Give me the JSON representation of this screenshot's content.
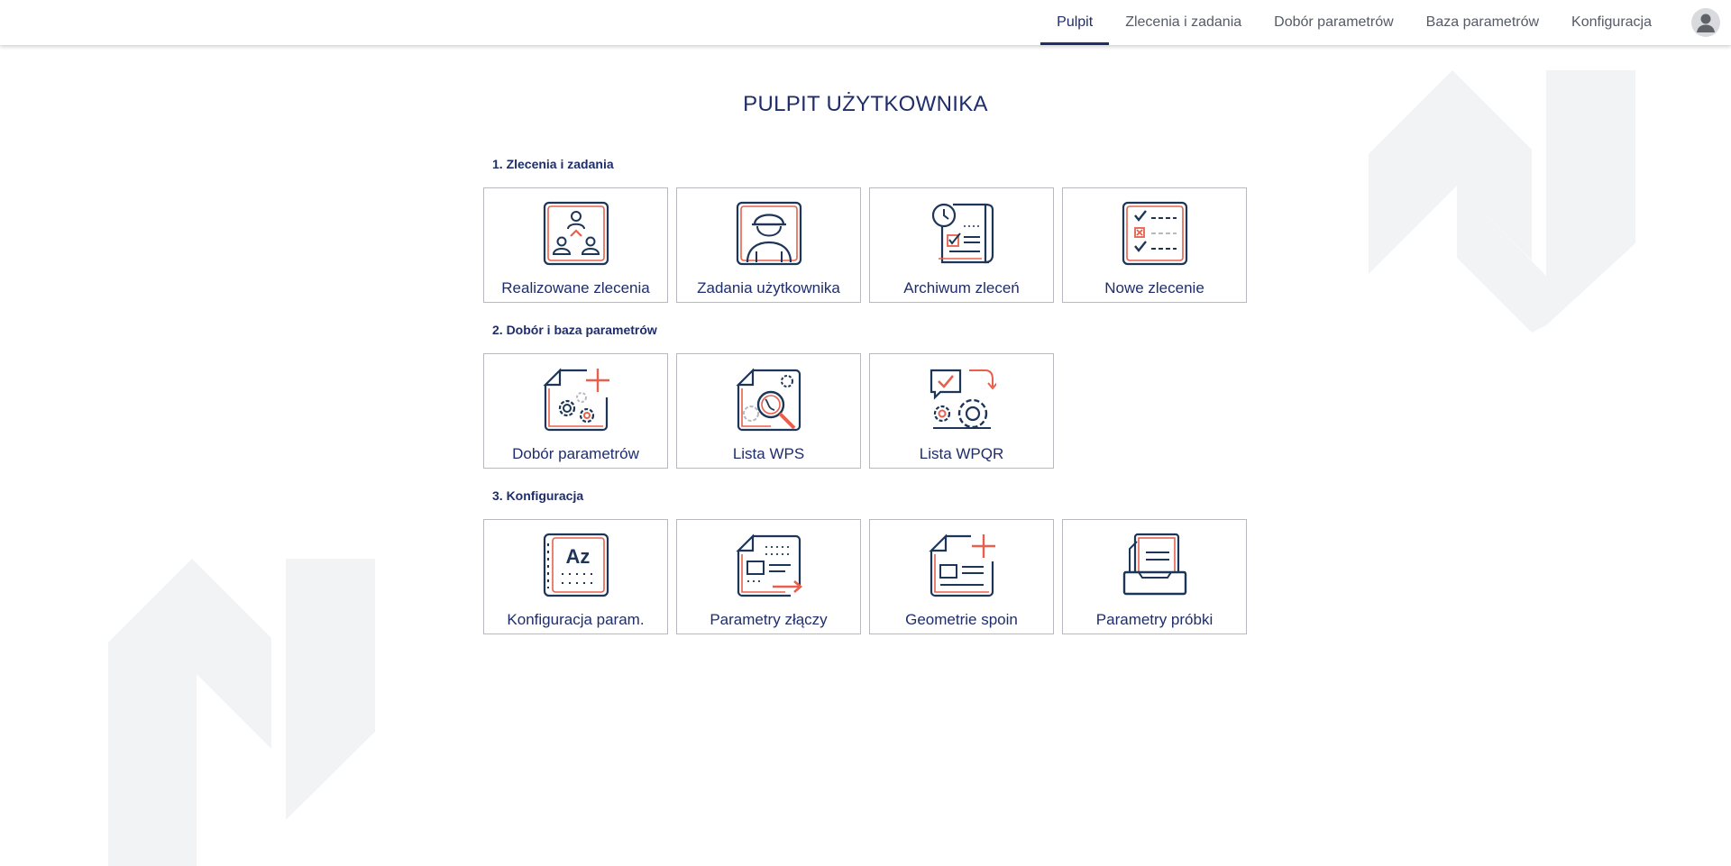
{
  "colors": {
    "primary": "#1f2d6b",
    "icon_dark": "#1d3557",
    "icon_accent": "#e8604c",
    "tile_border": "#b7b9bf",
    "watermark": "#f2f3f5"
  },
  "nav": {
    "items": [
      {
        "label": "Pulpit",
        "active": true
      },
      {
        "label": "Zlecenia i zadania",
        "active": false
      },
      {
        "label": "Dobór parametrów",
        "active": false
      },
      {
        "label": "Baza parametrów",
        "active": false
      },
      {
        "label": "Konfiguracja",
        "active": false
      }
    ],
    "avatar_icon": "user-avatar-icon"
  },
  "page": {
    "title": "PULPIT UŻYTKOWNIKA"
  },
  "sections": [
    {
      "title": "1. Zlecenia i zadania",
      "tiles": [
        {
          "label": "Realizowane zlecenia",
          "icon": "team-hierarchy-icon"
        },
        {
          "label": "Zadania użytkownika",
          "icon": "worker-helmet-icon"
        },
        {
          "label": "Archiwum zleceń",
          "icon": "clock-document-icon"
        },
        {
          "label": "Nowe zlecenie",
          "icon": "checklist-icon"
        }
      ]
    },
    {
      "title": "2. Dobór i baza parametrów",
      "tiles": [
        {
          "label": "Dobór parametrów",
          "icon": "gears-add-icon"
        },
        {
          "label": "Lista WPS",
          "icon": "magnifier-gears-icon"
        },
        {
          "label": "Lista WPQR",
          "icon": "chat-check-gears-icon"
        }
      ]
    },
    {
      "title": "3. Konfiguracja",
      "tiles": [
        {
          "label": "Konfiguracja param.",
          "icon": "az-notebook-icon"
        },
        {
          "label": "Parametry złączy",
          "icon": "document-arrow-icon"
        },
        {
          "label": "Geometrie spoin",
          "icon": "document-add-icon"
        },
        {
          "label": "Parametry próbki",
          "icon": "file-tray-icon"
        }
      ]
    }
  ]
}
